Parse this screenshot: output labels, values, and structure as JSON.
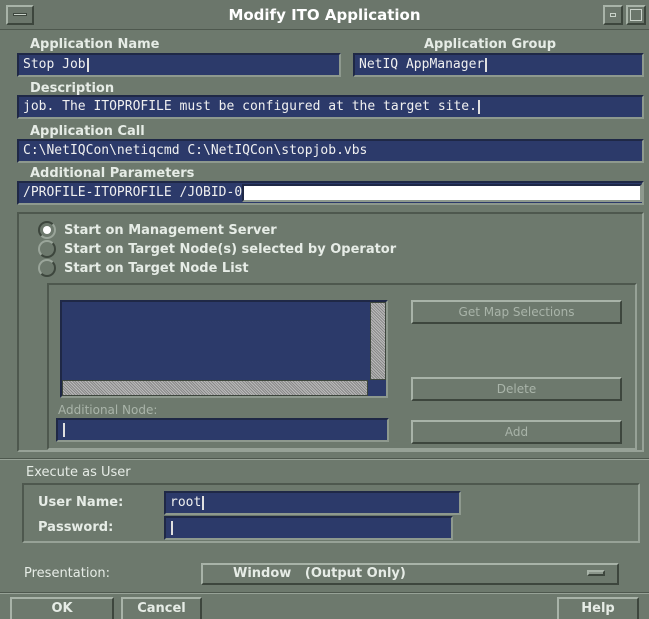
{
  "window": {
    "title": "Modify ITO Application"
  },
  "fields": {
    "application_name": {
      "label": "Application Name",
      "value": "Stop Job"
    },
    "application_group": {
      "label": "Application Group",
      "value": "NetIQ AppManager"
    },
    "description": {
      "label": "Description",
      "value": "job. The ITOPROFILE must be configured at the target site."
    },
    "application_call": {
      "label": "Application Call",
      "value": "C:\\NetIQCon\\netiqcmd C:\\NetIQCon\\stopjob.vbs"
    },
    "additional_parameters": {
      "label": "Additional Parameters",
      "value": "/PROFILE-ITOPROFILE /JOBID-"
    },
    "additional_parameters_cursor_char": "0"
  },
  "start_options": [
    {
      "label": "Start on Management Server",
      "selected": true
    },
    {
      "label": "Start on Target Node(s) selected by Operator",
      "selected": false
    },
    {
      "label": "Start on Target Node List",
      "selected": false
    }
  ],
  "node_list": {
    "get_map_selections": "Get Map Selections",
    "delete": "Delete",
    "additional_node_label": "Additional Node:",
    "additional_node_value": "",
    "add": "Add"
  },
  "execute_as": {
    "section_label": "Execute as User",
    "user_name_label": "User Name:",
    "user_name_value": "root",
    "password_label": "Password:",
    "password_value": ""
  },
  "presentation": {
    "label": "Presentation:",
    "selected": "Window   (Output Only)"
  },
  "buttons": {
    "ok": "OK",
    "cancel": "Cancel",
    "help": "Help"
  },
  "colors": {
    "dialog_bg": "#6d796d",
    "field_bg": "#2c3a6a",
    "text": "#e6ece6"
  }
}
